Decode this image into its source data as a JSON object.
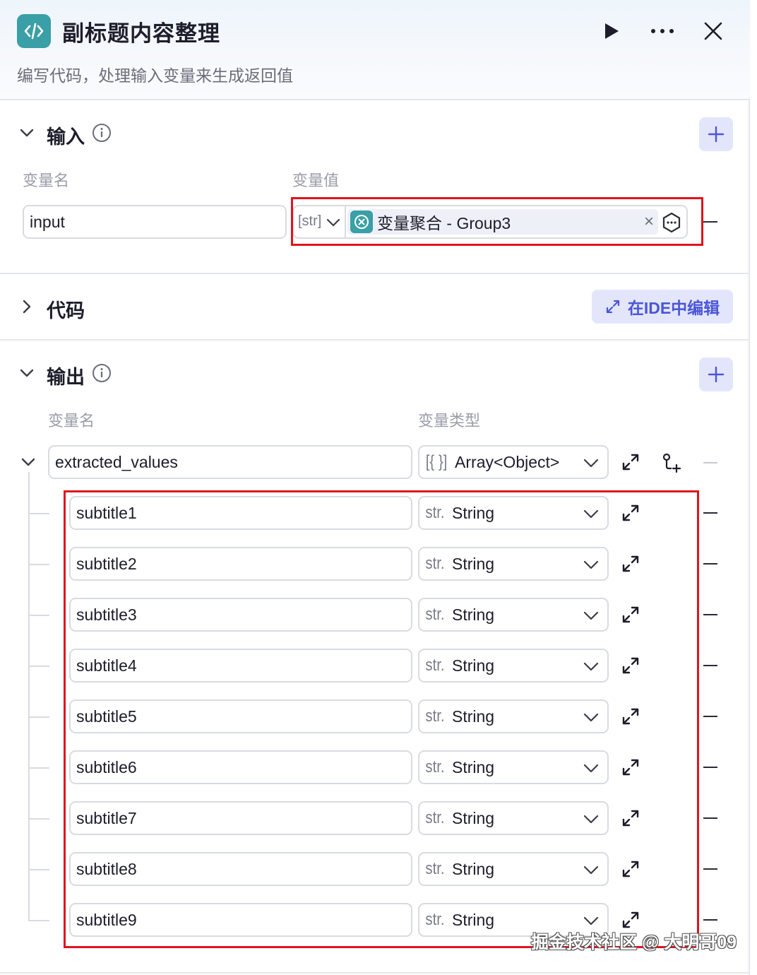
{
  "header": {
    "title": "副标题内容整理",
    "description": "编写代码，处理输入变量来生成返回值"
  },
  "input_section": {
    "title": "输入",
    "col_name": "变量名",
    "col_value": "变量值",
    "row": {
      "name": "input",
      "type_tag": "[str]",
      "ref_label": "变量聚合 - Group3",
      "ref_close": "×"
    }
  },
  "code_section": {
    "title": "代码",
    "ide_button": "在IDE中编辑"
  },
  "output_section": {
    "title": "输出",
    "col_name": "变量名",
    "col_type": "变量类型",
    "parent": {
      "name": "extracted_values",
      "type_prefix": "[{ }]",
      "type": "Array<Object>"
    },
    "children": [
      {
        "name": "subtitle1",
        "type_prefix": "str.",
        "type": "String"
      },
      {
        "name": "subtitle2",
        "type_prefix": "str.",
        "type": "String"
      },
      {
        "name": "subtitle3",
        "type_prefix": "str.",
        "type": "String"
      },
      {
        "name": "subtitle4",
        "type_prefix": "str.",
        "type": "String"
      },
      {
        "name": "subtitle5",
        "type_prefix": "str.",
        "type": "String"
      },
      {
        "name": "subtitle6",
        "type_prefix": "str.",
        "type": "String"
      },
      {
        "name": "subtitle7",
        "type_prefix": "str.",
        "type": "String"
      },
      {
        "name": "subtitle8",
        "type_prefix": "str.",
        "type": "String"
      },
      {
        "name": "subtitle9",
        "type_prefix": "str.",
        "type": "String"
      }
    ]
  },
  "watermark": "掘金技术社区 @ 大明哥09",
  "colors": {
    "accent": "#4a55d8",
    "node_teal": "#3a9fa6",
    "highlight_red": "#e0141e"
  }
}
